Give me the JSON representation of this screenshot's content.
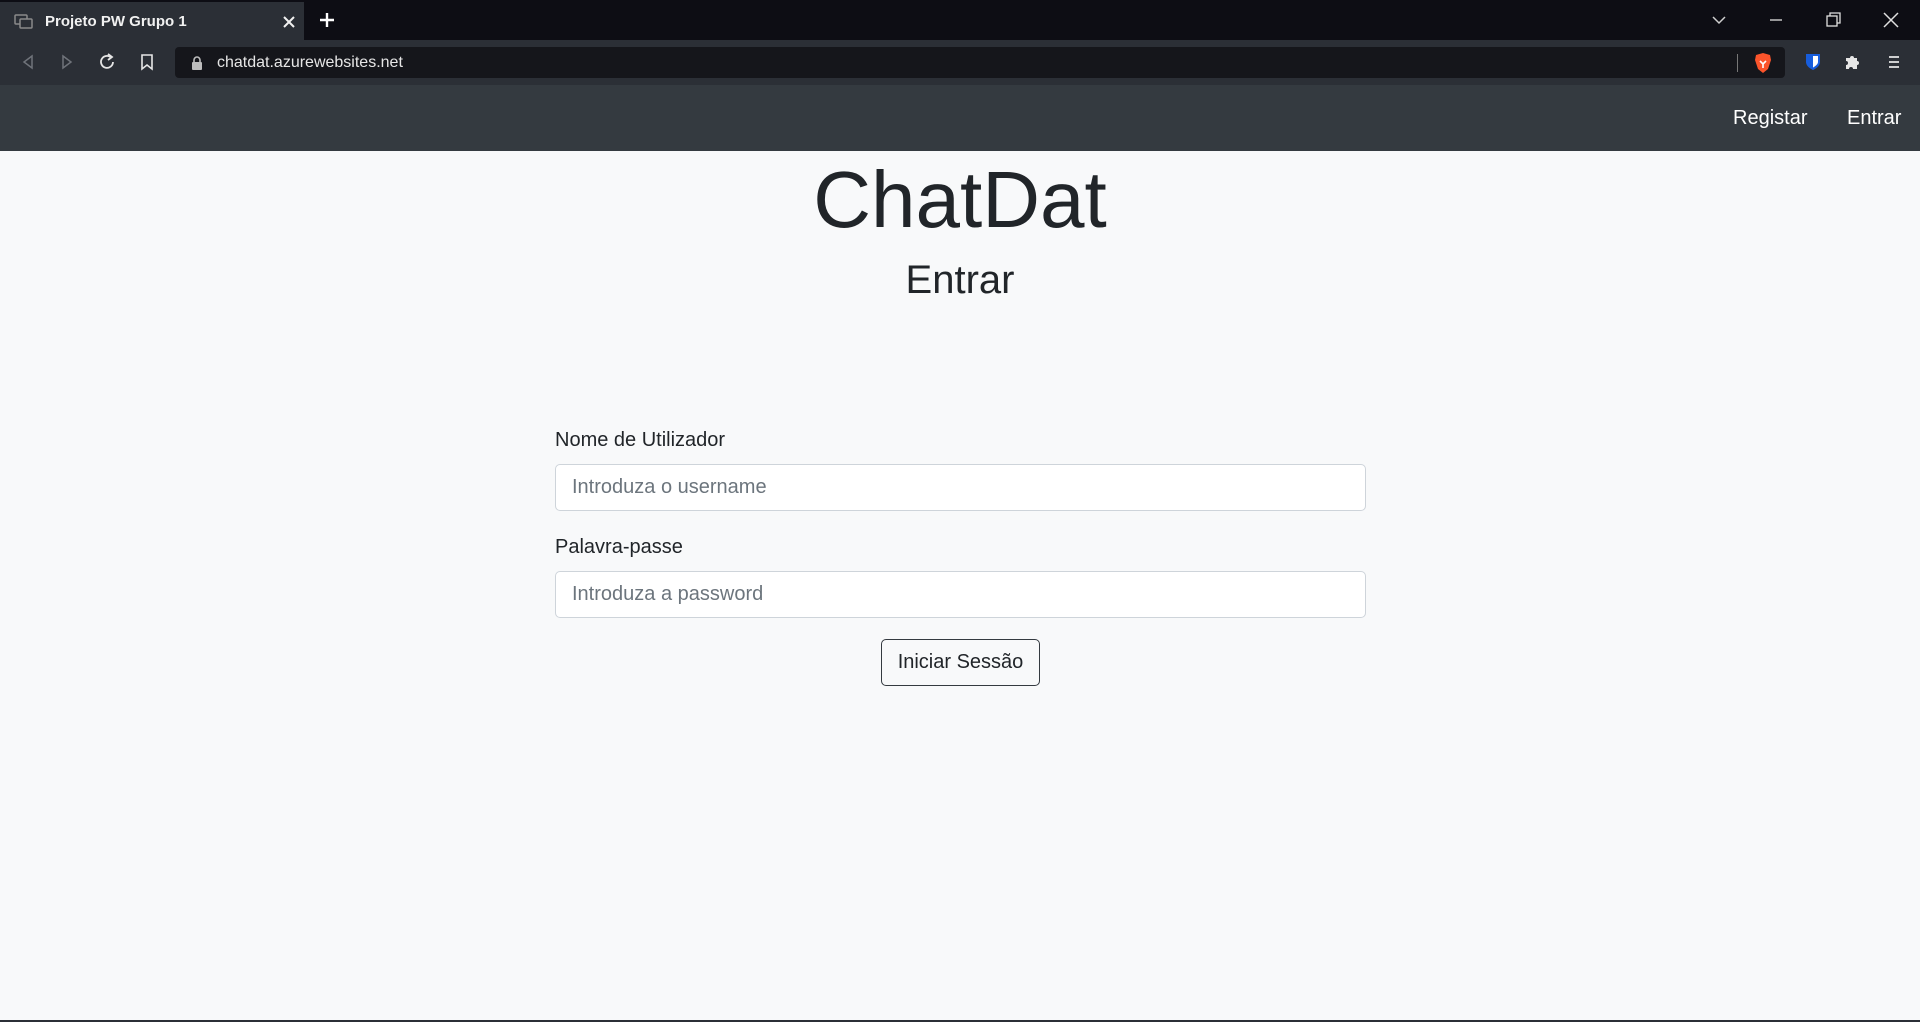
{
  "browser": {
    "tab_title": "Projeto PW Grupo 1",
    "url": "chatdat.azurewebsites.net"
  },
  "navbar": {
    "register_label": "Registar",
    "login_label": "Entrar"
  },
  "main": {
    "brand": "ChatDat",
    "subtitle": "Entrar"
  },
  "form": {
    "username_label": "Nome de Utilizador",
    "username_placeholder": "Introduza o username",
    "password_label": "Palavra-passe",
    "password_placeholder": "Introduza a password",
    "submit_label": "Iniciar Sessão"
  },
  "colors": {
    "navbar_bg": "#343a40",
    "page_bg": "#f8f9fa",
    "chrome_bg": "#2b2f36",
    "brave_accent": "#fb542b",
    "bitwarden_accent": "#175ddc"
  },
  "icons": [
    "chat-favicon-icon",
    "close-icon",
    "plus-icon",
    "chevron-down-icon",
    "minimize-icon",
    "restore-icon",
    "back-icon",
    "forward-icon",
    "reload-icon",
    "bookmark-icon",
    "lock-icon",
    "brave-shields-icon",
    "bitwarden-icon",
    "extensions-icon",
    "menu-icon"
  ]
}
